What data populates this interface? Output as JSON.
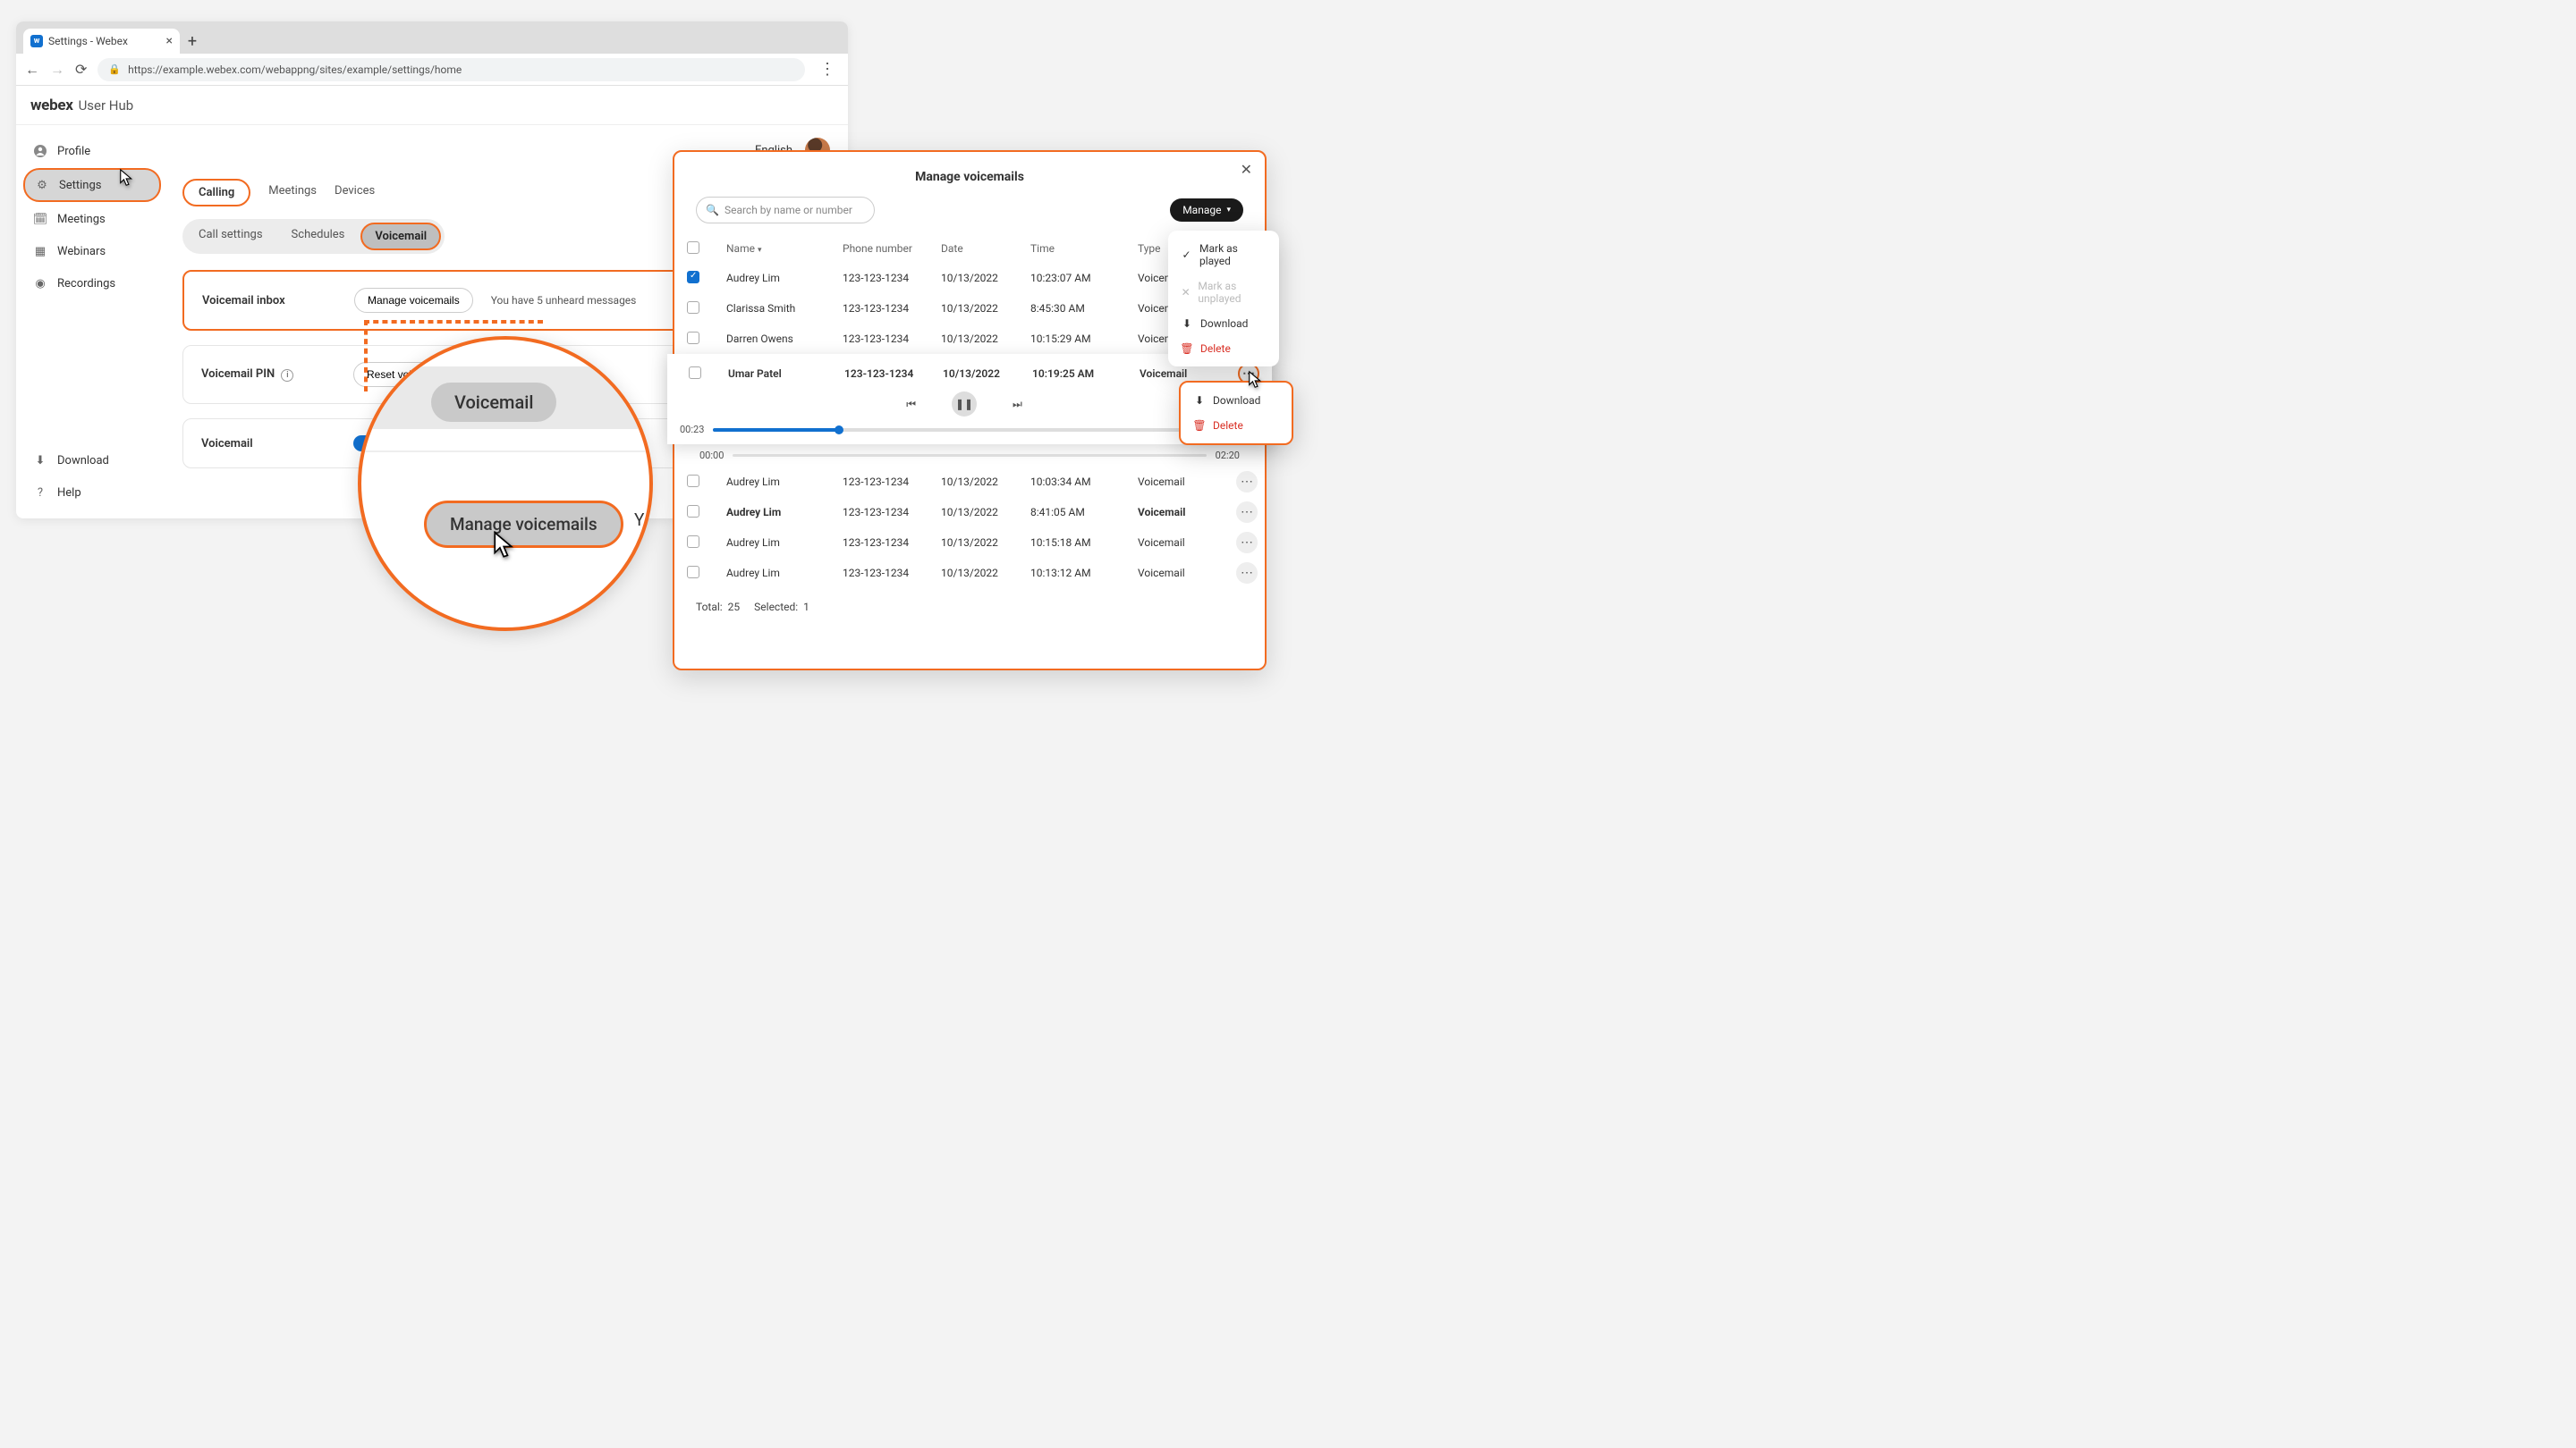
{
  "browser": {
    "tab_title": "Settings - Webex",
    "url": "https://example.webex.com/webappng/sites/example/settings/home"
  },
  "app": {
    "logo": "webex",
    "logo_sub": "User Hub",
    "language": "English"
  },
  "sidebar": {
    "items": [
      {
        "label": "Profile"
      },
      {
        "label": "Settings"
      },
      {
        "label": "Meetings"
      },
      {
        "label": "Webinars"
      },
      {
        "label": "Recordings"
      }
    ],
    "bottom": [
      {
        "label": "Download"
      },
      {
        "label": "Help"
      }
    ]
  },
  "tabs": {
    "items": [
      "Calling",
      "Meetings",
      "Devices"
    ]
  },
  "subtabs": {
    "items": [
      "Call settings",
      "Schedules",
      "Voicemail"
    ]
  },
  "cards": {
    "inbox": {
      "title": "Voicemail inbox",
      "button": "Manage voicemails",
      "status": "You have 5 unheard messages"
    },
    "pin": {
      "title": "Voicemail PIN",
      "button": "Reset voicemail PIN"
    },
    "voicemail": {
      "title": "Voicemail"
    }
  },
  "magnifier": {
    "vm_label": "Voicemail",
    "btn_label": "Manage voicemails",
    "y": "Y"
  },
  "modal": {
    "title": "Manage voicemails",
    "search_placeholder": "Search by name or number",
    "manage_label": "Manage",
    "columns": [
      "",
      "Name",
      "Phone number",
      "Date",
      "Time",
      "Type",
      ""
    ],
    "rows": [
      {
        "checked": true,
        "name": "Audrey Lim",
        "phone": "123-123-1234",
        "date": "10/13/2022",
        "time": "10:23:07 AM",
        "type": "Voicemail",
        "bold": false
      },
      {
        "checked": false,
        "name": "Clarissa Smith",
        "phone": "123-123-1234",
        "date": "10/13/2022",
        "time": "8:45:30 AM",
        "type": "Voicemail",
        "bold": false
      },
      {
        "checked": false,
        "name": "Darren Owens",
        "phone": "123-123-1234",
        "date": "10/13/2022",
        "time": "10:15:29 AM",
        "type": "Voicemail",
        "bold": false
      }
    ],
    "player": {
      "name": "Umar Patel",
      "phone": "123-123-1234",
      "date": "10/13/2022",
      "time": "10:19:25 AM",
      "type": "Voicemail",
      "elapsed": "00:23",
      "total": "02:20",
      "vol_start": "00:00",
      "vol_end": "02:20",
      "progress_pct": 25
    },
    "rows_after": [
      {
        "name": "Audrey Lim",
        "phone": "123-123-1234",
        "date": "10/13/2022",
        "time": "10:03:34 AM",
        "type": "Voicemail",
        "bold": false
      },
      {
        "name": "Audrey Lim",
        "phone": "123-123-1234",
        "date": "10/13/2022",
        "time": "8:41:05 AM",
        "type": "Voicemail",
        "bold": true
      },
      {
        "name": "Audrey Lim",
        "phone": "123-123-1234",
        "date": "10/13/2022",
        "time": "10:15:18 AM",
        "type": "Voicemail",
        "bold": false
      },
      {
        "name": "Audrey Lim",
        "phone": "123-123-1234",
        "date": "10/13/2022",
        "time": "10:13:12 AM",
        "type": "Voicemail",
        "bold": false
      }
    ],
    "footer": {
      "total_label": "Total:",
      "total_value": "25",
      "selected_label": "Selected:",
      "selected_value": "1"
    }
  },
  "manage_menu": {
    "items": [
      {
        "label": "Mark as played",
        "icon": "✓",
        "state": "normal"
      },
      {
        "label": "Mark as unplayed",
        "icon": "✕",
        "state": "disabled"
      },
      {
        "label": "Download",
        "icon": "⬇",
        "state": "normal"
      },
      {
        "label": "Delete",
        "icon": "🗑",
        "state": "danger"
      }
    ]
  },
  "row_menu": {
    "items": [
      {
        "label": "Download",
        "icon": "⬇",
        "state": "normal"
      },
      {
        "label": "Delete",
        "icon": "🗑",
        "state": "danger"
      }
    ]
  }
}
